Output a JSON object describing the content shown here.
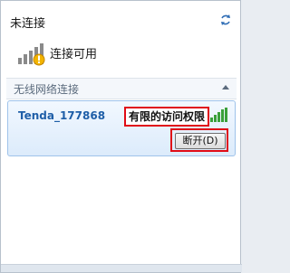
{
  "header": {
    "title": "未连接",
    "refresh_icon": "refresh-icon"
  },
  "status": {
    "icon": "wifi-warning-icon",
    "text": "连接可用"
  },
  "group": {
    "label": "无线网络连接",
    "collapse_icon": "chevron-up-icon"
  },
  "network": {
    "ssid": "Tenda_177868",
    "access": "有限的访问权限",
    "signal_icon": "signal-strength-icon",
    "disconnect_label": "断开(D)"
  },
  "colors": {
    "highlight_border": "#e00b16",
    "ssid_text": "#1f5fa8",
    "signal_green": "#3aa03a"
  }
}
